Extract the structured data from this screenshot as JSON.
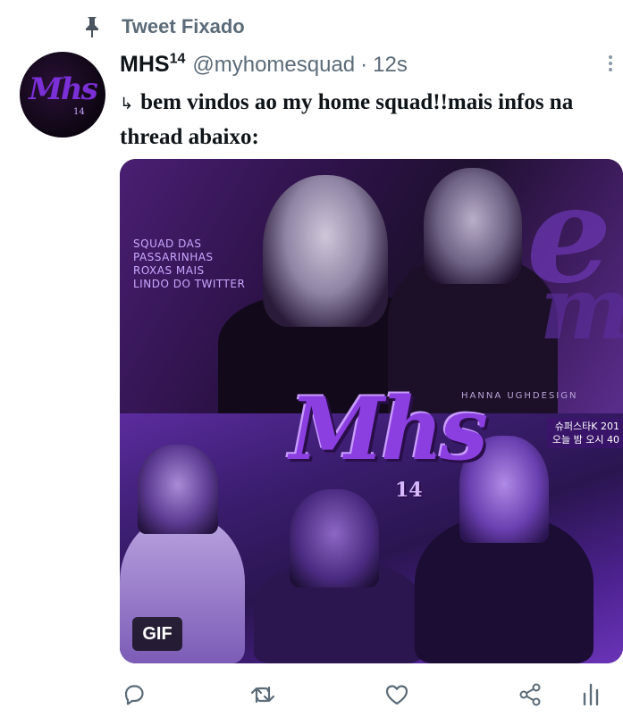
{
  "pinned": {
    "label": "Tweet Fixado",
    "icon": "pin-icon"
  },
  "tweet": {
    "author_name": "MHS",
    "author_name_sup": "14",
    "handle": "@myhomesquad",
    "separator": "·",
    "time": "12s",
    "arrow": "↳",
    "text": "bem vindos ao my home squad!!mais infos na thread abaixo:"
  },
  "avatar": {
    "logo_text": "Mhs",
    "logo_sub": "14"
  },
  "media": {
    "squad_text": "SQUAD DAS\nPASSARINHAS\nROXAS MAIS\nLINDO DO TWITTER",
    "credit": "HANNA UGHDESIGN",
    "logo_text": "Mhs",
    "logo_sub": "14",
    "korean_label": "슈퍼스타K 201\n오늘 밤 오시 40",
    "gif_badge": "GIF"
  },
  "actions": {
    "reply_icon": "reply-icon",
    "retweet_icon": "retweet-icon",
    "like_icon": "heart-icon",
    "share_icon": "share-icon",
    "analytics_icon": "analytics-icon"
  },
  "colors": {
    "muted": "#5b6b78",
    "text": "#0f1419",
    "accent_purple": "#7b2fd6"
  }
}
